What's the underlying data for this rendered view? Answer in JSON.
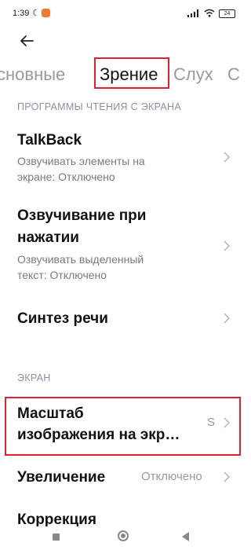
{
  "status_bar": {
    "time": "1:39",
    "battery": "24"
  },
  "tabs": [
    {
      "label": "сновные"
    },
    {
      "label": "Зрение"
    },
    {
      "label": "Слух"
    },
    {
      "label": "С"
    }
  ],
  "sections": {
    "screen_reader": "ПРОГРАММЫ ЧТЕНИЯ С ЭКРАНА",
    "screen": "ЭКРАН"
  },
  "items": {
    "talkback": {
      "title": "TalkBack",
      "subtitle1": "Озвучивать элементы на",
      "subtitle2": "экране: Отключено"
    },
    "select_to_speak": {
      "title1": "Озвучивание при",
      "title2": "нажатии",
      "subtitle1": "Озвучивать выделенный",
      "subtitle2": "текст: Отключено"
    },
    "tts": {
      "title": "Синтез речи"
    },
    "display_scale": {
      "title1": "Масштаб",
      "title2": "изображения на экр…",
      "value": "S"
    },
    "magnification": {
      "title": "Увеличение",
      "value": "Отключено"
    },
    "color_correction": {
      "title": "Коррекция"
    }
  },
  "colors": {
    "highlight": "#e02030",
    "section_header": "#8a8fa3"
  }
}
